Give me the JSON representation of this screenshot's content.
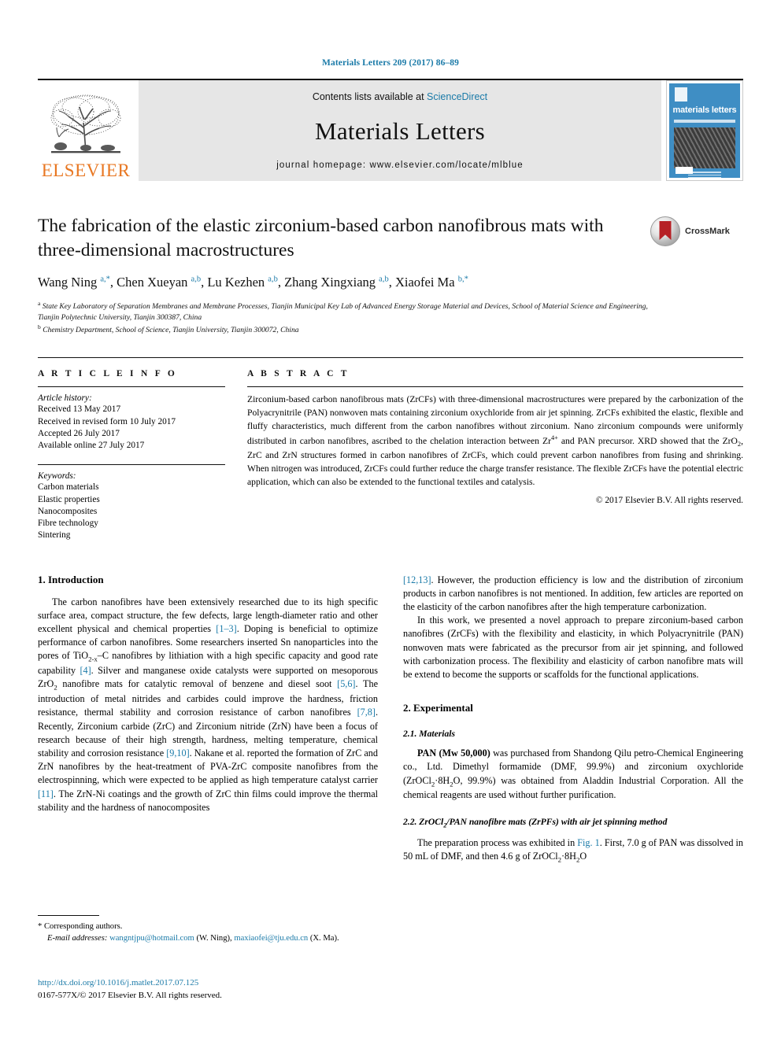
{
  "running_head": "Materials Letters 209 (2017) 86–89",
  "masthead": {
    "publisher_name": "ELSEVIER",
    "contents_prefix": "Contents lists available at ",
    "contents_link": "ScienceDirect",
    "journal_name": "Materials Letters",
    "homepage": "journal homepage: www.elsevier.com/locate/mlblue",
    "cover_title": "materials letters"
  },
  "article": {
    "title": "The fabrication of the elastic zirconium-based carbon nanofibrous mats with three-dimensional macrostructures",
    "crossmark_label": "CrossMark",
    "authors_html": "Wang Ning <sup>a,*</sup>, Chen Xueyan <sup>a,b</sup>, Lu Kezhen <sup>a,b</sup>, Zhang Xingxiang <sup>a,b</sup>, Xiaofei Ma <sup>b,*</sup>",
    "affiliation_a": "State Key Laboratory of Separation Membranes and Membrane Processes, Tianjin Municipal Key Lab of Advanced Energy Storage Material and Devices, School of Material Science and Engineering, Tianjin Polytechnic University, Tianjin 300387, China",
    "affiliation_b": "Chemistry Department, School of Science, Tianjin University, Tianjin 300072, China"
  },
  "article_info": {
    "heading": "A R T I C L E    I N F O",
    "history_label": "Article history:",
    "history": [
      "Received 13 May 2017",
      "Received in revised form 10 July 2017",
      "Accepted 26 July 2017",
      "Available online 27 July 2017"
    ],
    "keywords_label": "Keywords:",
    "keywords": [
      "Carbon materials",
      "Elastic properties",
      "Nanocomposites",
      "Fibre technology",
      "Sintering"
    ]
  },
  "abstract": {
    "heading": "A B S T R A C T",
    "text_html": "Zirconium-based carbon nanofibrous mats (ZrCFs) with three-dimensional macrostructures were prepared by the carbonization of the Polyacrynitrile (PAN) nonwoven mats containing zirconium oxychloride from air jet spinning. ZrCFs exhibited the elastic, flexible and fluffy characteristics, much different from the carbon nanofibres without zirconium. Nano zirconium compounds were uniformly distributed in carbon nanofibres, ascribed to the chelation interaction between Zr<sup class=\"num\">4+</sup> and PAN precursor. XRD showed that the ZrO<sub>2</sub>, ZrC and ZrN structures formed in carbon nanofibres of ZrCFs, which could prevent carbon nanofibres from fusing and shrinking. When nitrogen was introduced, ZrCFs could further reduce the charge transfer resistance. The flexible ZrCFs have the potential electric application, which can also be extended to the functional textiles and catalysis.",
    "copyright": "© 2017 Elsevier B.V. All rights reserved."
  },
  "sections": {
    "introduction_heading": "1. Introduction",
    "intro_p1_html": "The carbon nanofibres have been extensively researched due to its high specific surface area, compact structure, the few defects, large length-diameter ratio and other excellent physical and chemical properties <span class=\"ref\">[1–3]</span>. Doping is beneficial to optimize performance of carbon nanofibres. Some researchers inserted Sn nanoparticles into the pores of TiO<sub>2-x</sub>–C nanofibres by lithiation with a high specific capacity and good rate capability <span class=\"ref\">[4]</span>. Silver and manganese oxide catalysts were supported on mesoporous ZrO<sub>2</sub> nanofibre mats for catalytic removal of benzene and diesel soot <span class=\"ref\">[5,6]</span>. The introduction of metal nitrides and carbides could improve the hardness, friction resistance, thermal stability and corrosion resistance of carbon nanofibres <span class=\"ref\">[7,8]</span>. Recently, Zirconium carbide (ZrC) and Zirconium nitride (ZrN) have been a focus of research because of their high strength, hardness, melting temperature, chemical stability and corrosion resistance <span class=\"ref\">[9,10]</span>. Nakane et al. reported the formation of ZrC and ZrN nanofibres by the heat-treatment of PVA-ZrC composite nanofibres from the electrospinning, which were expected to be applied as high temperature catalyst carrier <span class=\"ref\">[11]</span>. The ZrN-Ni coatings and the growth of ZrC thin films could improve the thermal stability and the hardness of nanocomposites",
    "intro_p1_cont_html": "<span class=\"ref\">[12,13]</span>. However, the production efficiency is low and the distribution of zirconium products in carbon nanofibres is not mentioned. In addition, few articles are reported on the elasticity of the carbon nanofibres after the high temperature carbonization.",
    "intro_p2_html": "In this work, we presented a novel approach to prepare zirconium-based carbon nanofibres (ZrCFs) with the flexibility and elasticity, in which Polyacrynitrile (PAN) nonwoven mats were fabricated as the precursor from air jet spinning, and followed with carbonization process. The flexibility and elasticity of carbon nanofibre mats will be extend to become the supports or scaffolds for the functional applications.",
    "experimental_heading": "2. Experimental",
    "materials_heading": "2.1. Materials",
    "materials_p_html": "<b>PAN (Mw 50,000)</b> was purchased from Shandong Qilu petro-Chemical Engineering co., Ltd. Dimethyl formamide (DMF, 99.9%) and zirconium oxychloride (ZrOCl<sub>2</sub>·8H<sub>2</sub>O, 99.9%) was obtained from Aladdin Industrial Corporation. All the chemical reagents are used without further purification.",
    "spinning_heading_html": "2.2. ZrOCl<sub>2</sub>/PAN nanofibre mats (ZrPFs) with air jet spinning method",
    "spinning_p_html": "The preparation process was exhibited in <span class=\"ref\">Fig. 1</span>. First, 7.0 g of PAN was dissolved in 50 mL of DMF, and then 4.6 g of ZrOCl<sub>2</sub>·8H<sub>2</sub>O"
  },
  "footer": {
    "corresponding_marker": "*",
    "corresponding_text": "Corresponding authors.",
    "email_label": "E-mail addresses:",
    "email1": "wangntjpu@hotmail.com",
    "email1_owner": "(W. Ning),",
    "email2": "maxiaofei@tju.edu.cn",
    "email2_owner": "(X. Ma).",
    "doi": "http://dx.doi.org/10.1016/j.matlet.2017.07.125",
    "issn_line_html": "0167-577X/© 2017 Elsevier B.V. All rights reserved."
  },
  "colors": {
    "link": "#1a7aa8",
    "elsevier_orange": "#E87722",
    "cover_blue": "#3f8ec4",
    "crossmark_red": "#b62025"
  }
}
